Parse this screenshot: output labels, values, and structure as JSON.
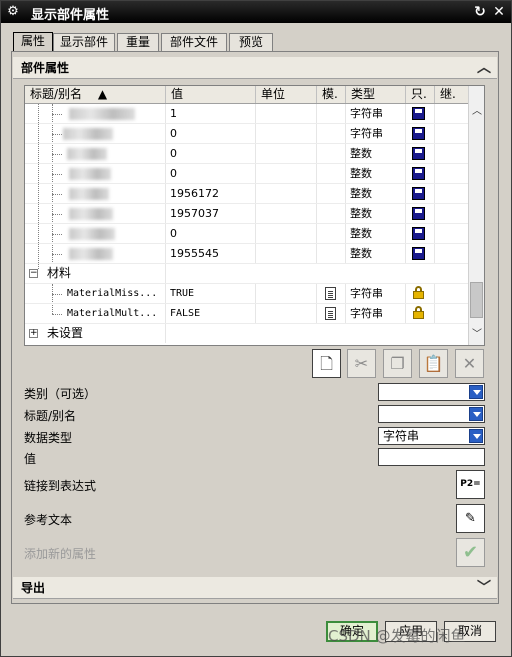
{
  "window": {
    "title": "显示部件属性"
  },
  "tabs": [
    {
      "label": "属性",
      "active": true
    },
    {
      "label": "显示部件",
      "active": false
    },
    {
      "label": "重量",
      "active": false
    },
    {
      "label": "部件文件",
      "active": false
    },
    {
      "label": "预览",
      "active": false
    }
  ],
  "section_attrs": {
    "title": "部件属性"
  },
  "table": {
    "columns": [
      "标题/别名",
      "值",
      "单位",
      "模.",
      "类型",
      "只.",
      "继."
    ],
    "rows": [
      {
        "value": "1",
        "type": "字符串",
        "readonly_icon": "save-icon"
      },
      {
        "value": "0",
        "type": "字符串",
        "readonly_icon": "save-icon"
      },
      {
        "value": "0",
        "type": "整数",
        "readonly_icon": "save-icon"
      },
      {
        "value": "0",
        "type": "整数",
        "readonly_icon": "save-icon"
      },
      {
        "value": "1956172",
        "type": "整数",
        "readonly_icon": "save-icon"
      },
      {
        "value": "1957037",
        "type": "整数",
        "readonly_icon": "save-icon"
      },
      {
        "value": "0",
        "type": "整数",
        "readonly_icon": "save-icon"
      },
      {
        "value": "1955545",
        "type": "整数",
        "readonly_icon": "save-icon"
      }
    ],
    "group_material": "材料",
    "material_rows": [
      {
        "title": "MaterialMiss...",
        "value": "TRUE",
        "type": "字符串",
        "readonly_icon": "lock-icon"
      },
      {
        "title": "MaterialMult...",
        "value": "FALSE",
        "type": "字符串",
        "readonly_icon": "lock-icon"
      }
    ],
    "group_unset": "未设置"
  },
  "form": {
    "category_label": "类别（可选）",
    "title_label": "标题/别名",
    "datatype_label": "数据类型",
    "datatype_value": "字符串",
    "value_label": "值",
    "link_label": "链接到表达式",
    "ref_text_label": "参考文本",
    "add_label": "添加新的属性"
  },
  "section_export": {
    "title": "导出"
  },
  "buttons": {
    "ok": "确定",
    "apply": "应用",
    "cancel": "取消"
  },
  "watermark": "CSDN @发霉的闲鱼"
}
